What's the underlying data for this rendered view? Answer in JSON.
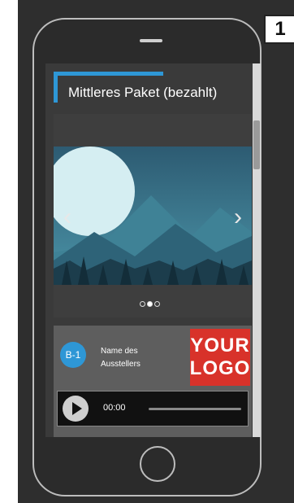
{
  "step_badge": "1",
  "screen": {
    "package_title": "Mittleres Paket (bezahlt)",
    "slider": {
      "prev_arrow": "‹",
      "next_arrow": "›",
      "dots_count": 3,
      "active_dot": 2
    },
    "exhibitor": {
      "booth": "B-1",
      "name": "Name des Ausstellers",
      "logo_line1": "YOUR",
      "logo_line2": "LOGO"
    },
    "audio": {
      "time": "00:00"
    }
  },
  "colors": {
    "accent": "#2e97d6",
    "logo_red": "#d8322a",
    "phone_body": "#2b2b2b"
  }
}
